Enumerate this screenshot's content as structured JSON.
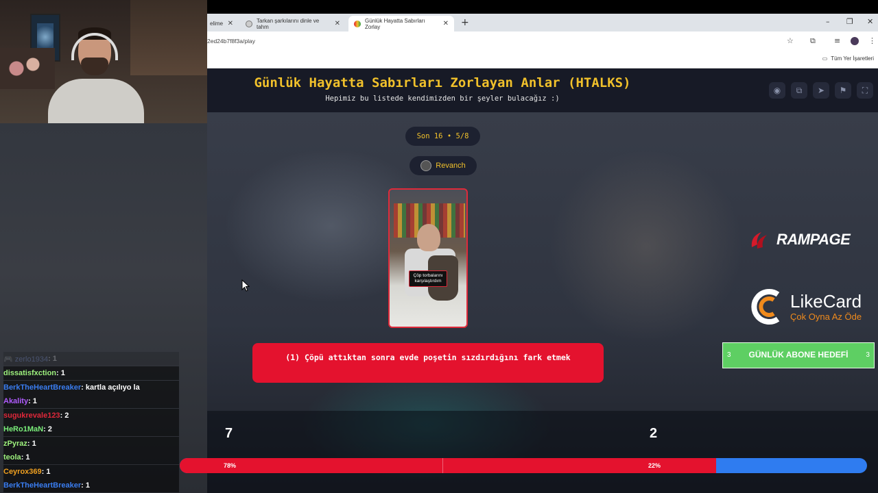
{
  "browser": {
    "tabs": [
      {
        "label": "elime",
        "active": false
      },
      {
        "label": "Tarkan şarkılarını dinle ve tahm",
        "active": false
      },
      {
        "label": "Günlük Hayatta Sabırları Zorlay",
        "active": true
      }
    ],
    "new_tab": "+",
    "url": "2ed24b7f8f3a/play",
    "bookmarks_label": "Tüm Yer İşaretleri",
    "window_controls": [
      "–",
      "❐",
      "✕"
    ]
  },
  "header": {
    "title": "Günlük Hayatta Sabırları Zorlayan Anlar (HTALKS)",
    "subtitle": "Hepimiz bu listede kendimizden bir şeyler bulacağız :)",
    "icons": [
      "eye-icon",
      "copy-icon",
      "send-icon",
      "flag-icon",
      "fullscreen-icon"
    ]
  },
  "round": {
    "label": "Son 16 • 5/8",
    "user": "Revanch"
  },
  "card": {
    "caption": "Çöp torbalarını karşılaştırdım"
  },
  "question": "(1) Çöpü attıktan sonra evde poşetin sızdırdığını fark etmek",
  "votes": {
    "left_count": "7",
    "right_count": "2",
    "left_percent_label": "78%",
    "right_percent_label": "22%",
    "left_fraction": 0.78,
    "left_color": "#e4122e",
    "right_color": "#2f7cf0"
  },
  "sponsors": {
    "rampage": "RAMPAGE",
    "likecard_name": "LikeCard",
    "likecard_slogan": "Çok Oyna Az Öde"
  },
  "goal": {
    "label": "GÜNLÜK ABONE HEDEFİ",
    "left": "3",
    "right": "3",
    "color": "#5ecf63"
  },
  "chat": [
    {
      "user": "🎮 zerlo1934",
      "text": ": 1",
      "color": "#8aa6ff",
      "faded": true
    },
    {
      "user": "dissatisfxction",
      "text": " : 1",
      "color": "#9ef27e",
      "faded": false
    },
    {
      "user": "BerkTheHeartBreaker",
      "text": " : kartla açılıyo la",
      "color": "#3a7df0",
      "faded": false
    },
    {
      "user": "Akality",
      "text": " : 1",
      "color": "#b05cff",
      "faded": false
    },
    {
      "user": "sugukrevale123",
      "text": " : 2",
      "color": "#e0283a",
      "faded": false
    },
    {
      "user": "HeRo1MaN",
      "text": " : 2",
      "color": "#7bf07b",
      "faded": false
    },
    {
      "user": "zPyraz",
      "text": " : 1",
      "color": "#9ef27e",
      "faded": false
    },
    {
      "user": "teola",
      "text": " : 1",
      "color": "#9ef27e",
      "faded": false
    },
    {
      "user": "Ceyrox369",
      "text": " : 1",
      "color": "#f0a020",
      "faded": false
    },
    {
      "user": "BerkTheHeartBreaker",
      "text": " : 1",
      "color": "#3a7df0",
      "faded": false
    }
  ]
}
